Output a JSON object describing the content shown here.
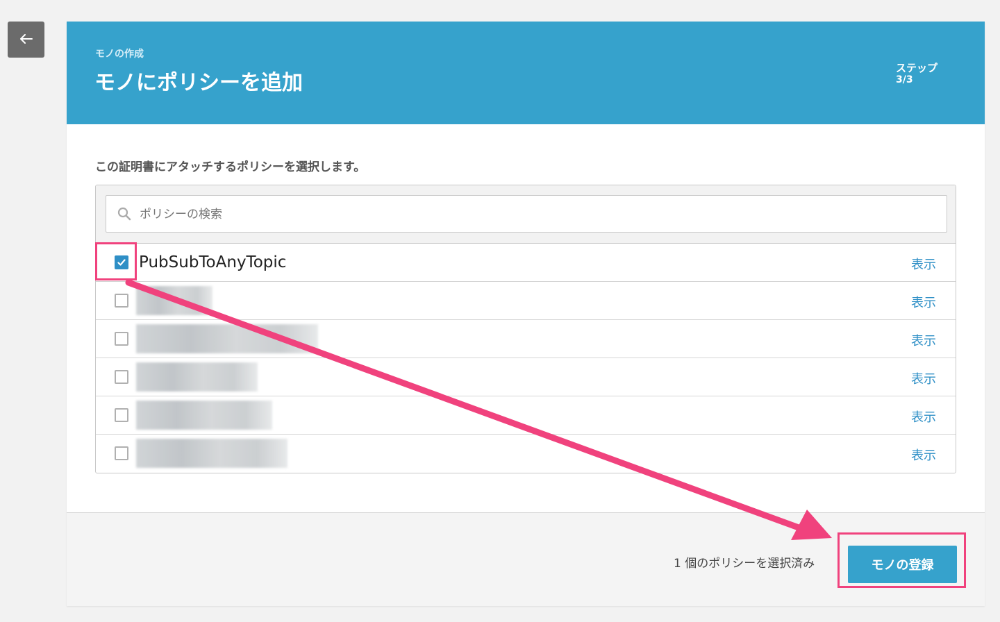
{
  "back_button": {
    "icon": "arrow-left-icon"
  },
  "header": {
    "breadcrumb": "モノの作成",
    "title": "モノにポリシーを追加",
    "step_label": "ステップ",
    "step_count": "3/3",
    "background_color": "#36a2cc"
  },
  "instruction": "この証明書にアタッチするポリシーを選択します。",
  "search": {
    "placeholder": "ポリシーの検索",
    "value": "",
    "icon": "search-icon"
  },
  "policies": [
    {
      "name": "PubSubToAnyTopic",
      "checked": true,
      "redacted": false,
      "view_label": "表示"
    },
    {
      "name": "",
      "checked": false,
      "redacted": true,
      "view_label": "表示"
    },
    {
      "name": "",
      "checked": false,
      "redacted": true,
      "view_label": "表示"
    },
    {
      "name": "",
      "checked": false,
      "redacted": true,
      "view_label": "表示"
    },
    {
      "name": "",
      "checked": false,
      "redacted": true,
      "view_label": "表示"
    },
    {
      "name": "",
      "checked": false,
      "redacted": true,
      "view_label": "表示"
    }
  ],
  "footer": {
    "status_text": "1 個のポリシーを選択済み",
    "register_label": "モノの登録"
  },
  "colors": {
    "accent": "#36a2cc",
    "link": "#2e8fc6",
    "annotation": "#f0427d"
  }
}
